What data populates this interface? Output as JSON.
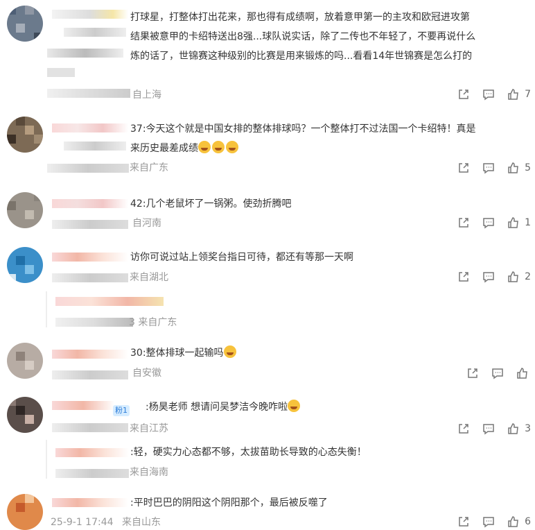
{
  "comments": [
    {
      "lines": [
        "打球星，打整体打出花来，那也得有成绩啊，放着意甲第一的主攻和欧冠进攻第",
        "结果被意甲的卡绍特送出8强...球队说实话，除了二传也不年轻了，不要再说什么",
        "炼的话了，世锦赛这种级别的比赛是用来锻炼的吗...看看14年世锦赛是怎么打的"
      ],
      "location": "自上海",
      "likes": "7"
    },
    {
      "lines": [
        "37:今天这个就是中国女排的整体排球吗？一个整体打不过法国一个卡绍特！真是",
        "来历史最差成绩"
      ],
      "emojis": [
        "laugh-cry",
        "laugh-cry",
        "laugh-cry"
      ],
      "location": "来自广东",
      "likes": "5"
    },
    {
      "lines": [
        "42:几个老鼠坏了一锅粥。使劲折腾吧"
      ],
      "location": "自河南",
      "likes": "1"
    },
    {
      "lines": [
        "访你可说过站上领奖台指日可待，都还有等那一天啊"
      ],
      "location": "来自湖北",
      "likes": "2",
      "reply_location": "3 来自广东"
    },
    {
      "lines": [
        "30:整体排球一起输吗"
      ],
      "location": "自安徽",
      "likes": ""
    },
    {
      "lines": [
        ":杨昊老师 想请问吴梦洁今晚咋啦"
      ],
      "badge": "粉1",
      "location": "来自江苏",
      "likes": "3",
      "reply_text": ":轻，硬实力心态都不够，太拔苗助长导致的心态失衡！",
      "reply_location": "来自海南"
    },
    {
      "lines": [
        ":平时巴巴的阴阳这个阴阳那个，最后被反噬了"
      ],
      "date": "25-9-1 17:44",
      "location": "来自山东",
      "likes": "6"
    }
  ]
}
